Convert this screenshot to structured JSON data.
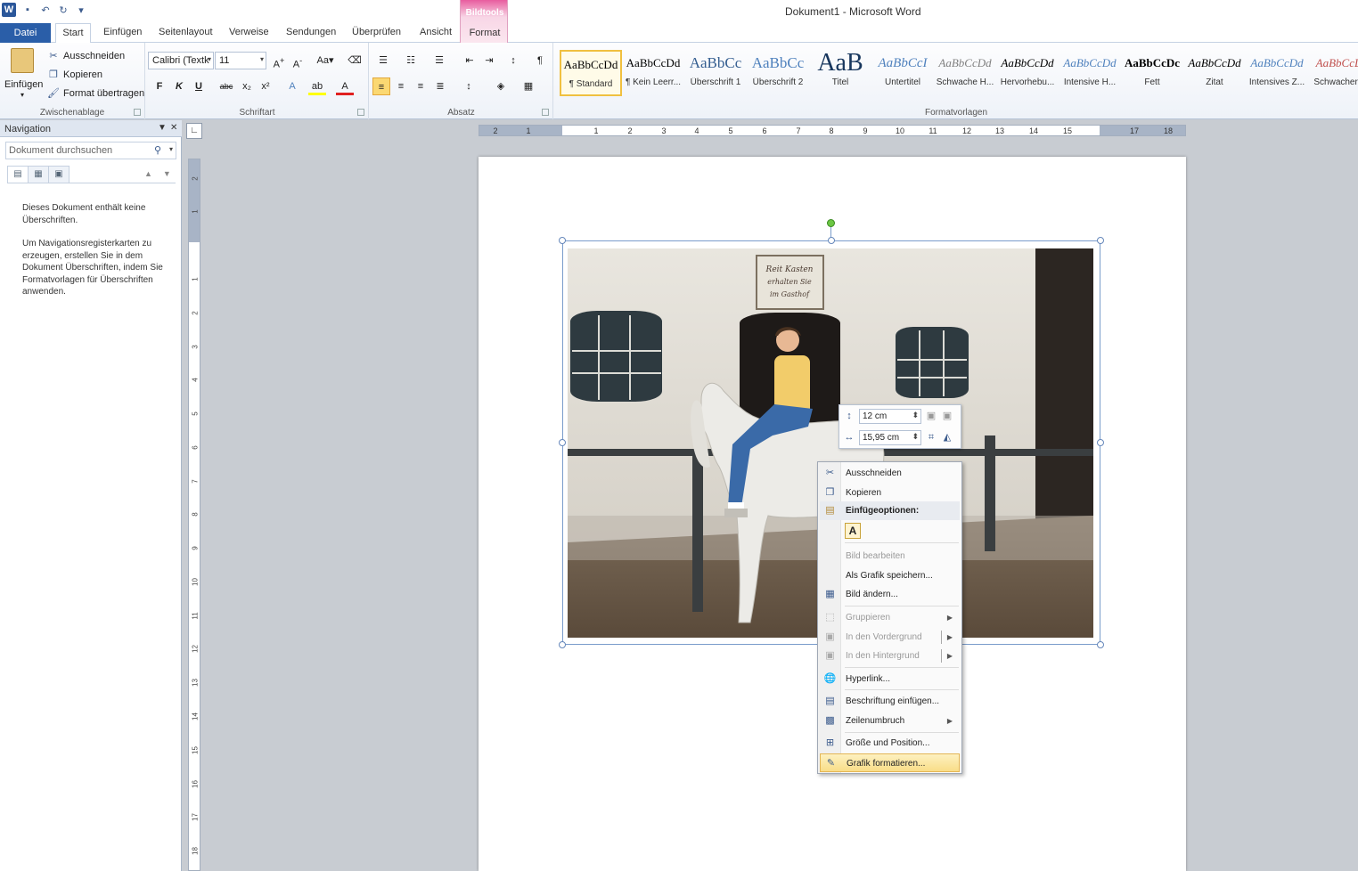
{
  "window": {
    "title": "Dokument1  -  Microsoft Word"
  },
  "tabs": {
    "file": "Datei",
    "items": [
      "Start",
      "Einfügen",
      "Seitenlayout",
      "Verweise",
      "Sendungen",
      "Überprüfen",
      "Ansicht"
    ],
    "contextual_group": "Bildtools",
    "contextual_tab": "Format"
  },
  "ribbon": {
    "clipboard": {
      "paste": "Einfügen",
      "cut": "Ausschneiden",
      "copy": "Kopieren",
      "format_painter": "Format übertragen",
      "label": "Zwischenablage"
    },
    "font": {
      "font_name": "Calibri (Textk",
      "font_size": "11",
      "label": "Schriftart"
    },
    "paragraph": {
      "label": "Absatz"
    },
    "styles": {
      "label": "Formatvorlagen",
      "items": [
        {
          "sample": "AaBbCcDd",
          "name": "¶ Standard",
          "color": "#000000"
        },
        {
          "sample": "AaBbCcDd",
          "name": "¶ Kein Leerr...",
          "color": "#000000"
        },
        {
          "sample": "AaBbCc",
          "name": "Überschrift 1",
          "color": "#365f91"
        },
        {
          "sample": "AaBbCc",
          "name": "Überschrift 2",
          "color": "#4f81bd"
        },
        {
          "sample": "AaB",
          "name": "Titel",
          "color": "#17365d"
        },
        {
          "sample": "AaBbCcI",
          "name": "Untertitel",
          "color": "#4f81bd"
        },
        {
          "sample": "AaBbCcDd",
          "name": "Schwache H...",
          "color": "#808080"
        },
        {
          "sample": "AaBbCcDd",
          "name": "Hervorhebu...",
          "color": "#000000"
        },
        {
          "sample": "AaBbCcDd",
          "name": "Intensive H...",
          "color": "#4f81bd"
        },
        {
          "sample": "AaBbCcDc",
          "name": "Fett",
          "color": "#000000"
        },
        {
          "sample": "AaBbCcDd",
          "name": "Zitat",
          "color": "#000000"
        },
        {
          "sample": "AaBbCcDd",
          "name": "Intensives Z...",
          "color": "#4f81bd"
        },
        {
          "sample": "AaBbCcD",
          "name": "Schwacher...",
          "color": "#c0504d"
        }
      ]
    }
  },
  "navigation": {
    "title": "Navigation",
    "search_placeholder": "Dokument durchsuchen",
    "message1": "Dieses Dokument enthält keine Überschriften.",
    "message2": "Um Navigationsregisterkarten zu erzeugen, erstellen Sie in dem Dokument Überschriften, indem Sie Formatvorlagen für Überschriften anwenden."
  },
  "ruler": {
    "h_labels": [
      "2",
      "1",
      "1",
      "2",
      "3",
      "4",
      "5",
      "6",
      "7",
      "8",
      "9",
      "10",
      "11",
      "12",
      "13",
      "14",
      "15",
      "17",
      "18"
    ],
    "v_labels": [
      "2",
      "1",
      "1",
      "2",
      "3",
      "4",
      "5",
      "6",
      "7",
      "8",
      "9",
      "10",
      "11",
      "12",
      "13",
      "14",
      "15",
      "16",
      "17",
      "18"
    ]
  },
  "mini_toolbar": {
    "height": "12  cm",
    "width": "15,95  cm"
  },
  "context_menu": {
    "items": [
      {
        "label": "Ausschneiden",
        "icon": "scissors-icon",
        "state": "normal"
      },
      {
        "label": "Kopieren",
        "icon": "copy-icon",
        "state": "normal"
      },
      {
        "label": "Einfügeoptionen:",
        "icon": "paste-icon",
        "state": "bold"
      },
      {
        "label": "Bild bearbeiten",
        "icon": "",
        "state": "disabled"
      },
      {
        "label": "Als Grafik speichern...",
        "icon": "",
        "state": "normal"
      },
      {
        "label": "Bild ändern...",
        "icon": "change-picture-icon",
        "state": "normal"
      },
      {
        "label": "Gruppieren",
        "icon": "group-icon",
        "state": "disabled",
        "submenu": true
      },
      {
        "label": "In den Vordergrund",
        "icon": "bring-forward-icon",
        "state": "disabled",
        "submenu": true
      },
      {
        "label": "In den Hintergrund",
        "icon": "send-backward-icon",
        "state": "disabled",
        "submenu": true
      },
      {
        "label": "Hyperlink...",
        "icon": "hyperlink-icon",
        "state": "normal"
      },
      {
        "label": "Beschriftung einfügen...",
        "icon": "caption-icon",
        "state": "normal"
      },
      {
        "label": "Zeilenumbruch",
        "icon": "wrap-icon",
        "state": "normal",
        "submenu": true
      },
      {
        "label": "Größe und Position...",
        "icon": "size-position-icon",
        "state": "normal"
      },
      {
        "label": "Grafik formatieren...",
        "icon": "format-picture-icon",
        "state": "highlighted"
      }
    ],
    "paste_option": "A"
  },
  "photo": {
    "sign_text": "Reit Kasten erhalten Sie im Gasthof"
  }
}
